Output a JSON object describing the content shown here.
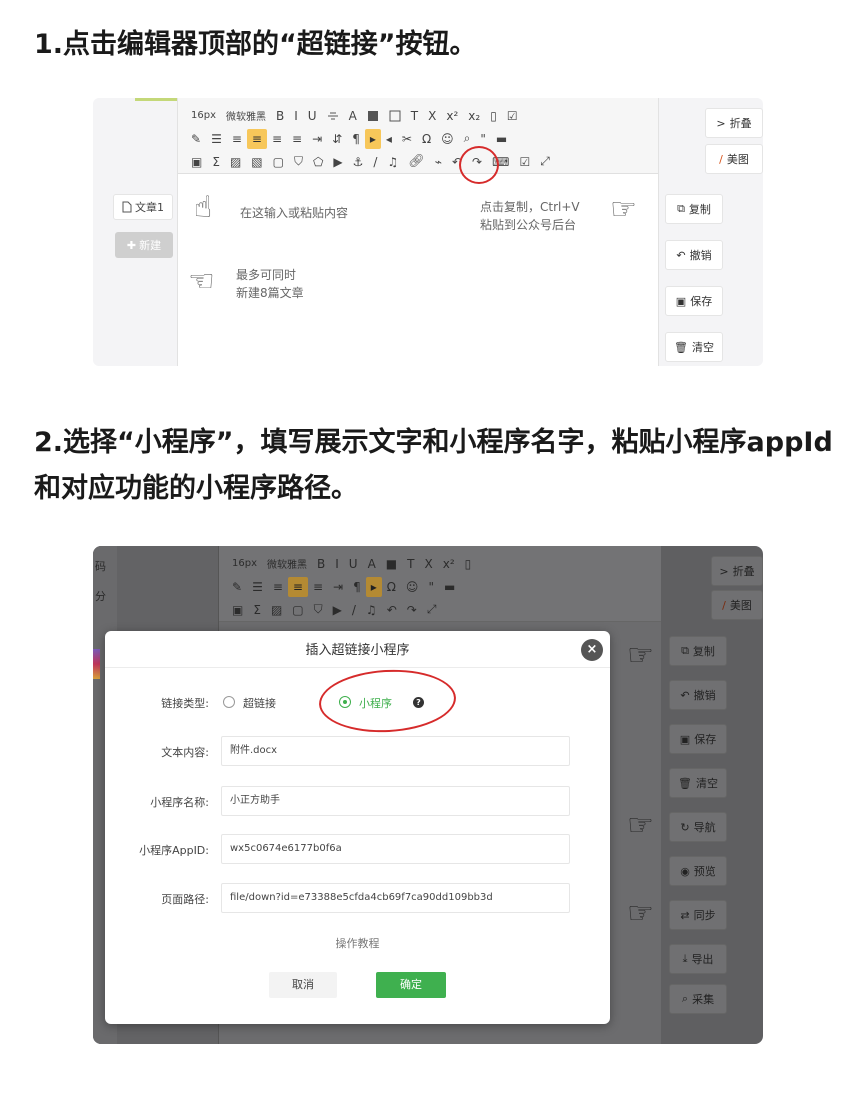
{
  "steps": [
    {
      "heading": "1.点击编辑器顶部的“超链接”按钮。"
    },
    {
      "heading": "2.选择“小程序”，填写展示文字和小程序名字，粘贴小程序appId和对应功能的小程序路径。"
    }
  ],
  "toolbar": {
    "font_size": "16px",
    "font_family": "微软雅黑",
    "row1": [
      "B",
      "I",
      "U",
      "A",
      "T",
      "X",
      "x²",
      "x₂"
    ],
    "row2": [
      "Ω",
      "\""
    ],
    "row3": [
      "Σ"
    ]
  },
  "shot1": {
    "right_top_buttons": [
      {
        "icon": "chevron-right-icon",
        "label": "折叠"
      },
      {
        "icon": "brush-icon",
        "label": "美图"
      }
    ],
    "left": {
      "doc_tab": "文章1",
      "new_button": "新建"
    },
    "hints": {
      "input": "在这输入或粘贴内容",
      "copy_line1": "点击复制，Ctrl+V",
      "copy_line2": "粘贴到公众号后台",
      "multi_line1": "最多可同时",
      "multi_line2": "新建8篇文章"
    },
    "right_buttons": [
      {
        "icon": "copy-icon",
        "label": "复制"
      },
      {
        "icon": "undo-icon",
        "label": "撤销"
      },
      {
        "icon": "save-icon",
        "label": "保存"
      },
      {
        "icon": "trash-icon",
        "label": "清空"
      }
    ]
  },
  "shot2": {
    "left_text": [
      "码",
      "分"
    ],
    "right_top_buttons": [
      {
        "icon": "chevron-right-icon",
        "label": "折叠"
      },
      {
        "icon": "brush-icon",
        "label": "美图"
      }
    ],
    "right_buttons": [
      {
        "icon": "copy-icon",
        "label": "复制"
      },
      {
        "icon": "undo-icon",
        "label": "撤销"
      },
      {
        "icon": "save-icon",
        "label": "保存"
      },
      {
        "icon": "trash-icon",
        "label": "清空"
      },
      {
        "icon": "refresh-icon",
        "label": "导航"
      },
      {
        "icon": "eye-icon",
        "label": "预览"
      },
      {
        "icon": "sync-icon",
        "label": "同步"
      },
      {
        "icon": "export-icon",
        "label": "导出"
      },
      {
        "icon": "search-icon",
        "label": "采集"
      }
    ],
    "dialog": {
      "title": "插入超链接小程序",
      "link_type_label": "链接类型:",
      "option_hyperlink": "超链接",
      "option_miniprogram": "小程序",
      "text_label": "文本内容:",
      "text_value": "附件.docx",
      "name_label": "小程序名称:",
      "name_value": "小正方助手",
      "appid_label": "小程序AppID:",
      "appid_value": "wx5c0674e6177b0f6a",
      "path_label": "页面路径:",
      "path_value": "file/down?id=e73388e5cfda4cb69f7ca90dd109bb3d",
      "tutorial": "操作教程",
      "cancel": "取消",
      "confirm": "确定"
    }
  }
}
